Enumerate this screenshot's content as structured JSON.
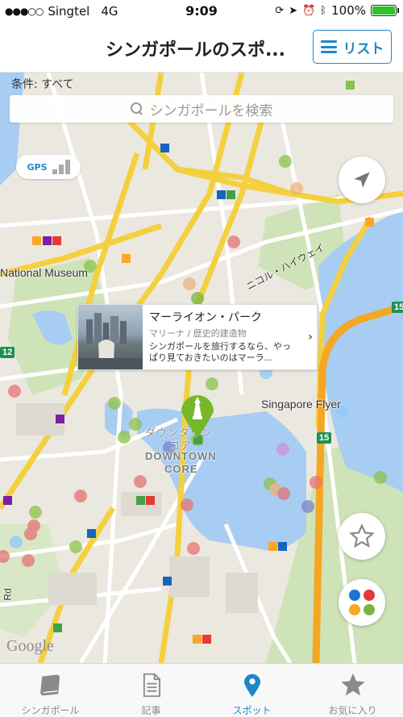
{
  "status": {
    "signal": "●●●○○",
    "carrier": "Singtel",
    "network": "4G",
    "time": "9:09",
    "battery": "100%",
    "battery_level": 1.0,
    "icons": [
      "rotation-lock-icon",
      "location-arrow-icon",
      "alarm-icon",
      "bluetooth-icon"
    ]
  },
  "header": {
    "title": "シンガポールのスポ...",
    "list_button": "リスト"
  },
  "map": {
    "condition": "条件: すべて",
    "search_placeholder": "シンガポールを検索",
    "gps_label": "GPS",
    "labels": {
      "national_museum": "National Museum",
      "singapore_flyer": "Singapore Flyer",
      "downtown_jp": "ダウンタウン",
      "downtown_jp2": "コア",
      "downtown_core": "DOWNTOWN",
      "downtown_core2": "CORE",
      "highway": "ニコル・ハイウェイ",
      "google": "Google",
      "road": "Rd"
    },
    "highway_shields": [
      "15",
      "15",
      "12"
    ],
    "popup": {
      "title": "マーライオン・パーク",
      "category": "マリーナ / 歴史的建造物",
      "description": "シンガポールを旅行するなら、やっぱり見ておきたいのはマーラ..."
    },
    "category_colors": [
      "#1976d2",
      "#e53935",
      "#f9a825",
      "#7cb342"
    ],
    "accent": "#1e88c6",
    "pin_color": "#76b82a"
  },
  "tabs": [
    {
      "label": "シンガポール",
      "icon": "book-icon"
    },
    {
      "label": "記事",
      "icon": "document-icon"
    },
    {
      "label": "スポット",
      "icon": "map-pin-icon",
      "active": true
    },
    {
      "label": "お気に入り",
      "icon": "star-icon"
    }
  ]
}
